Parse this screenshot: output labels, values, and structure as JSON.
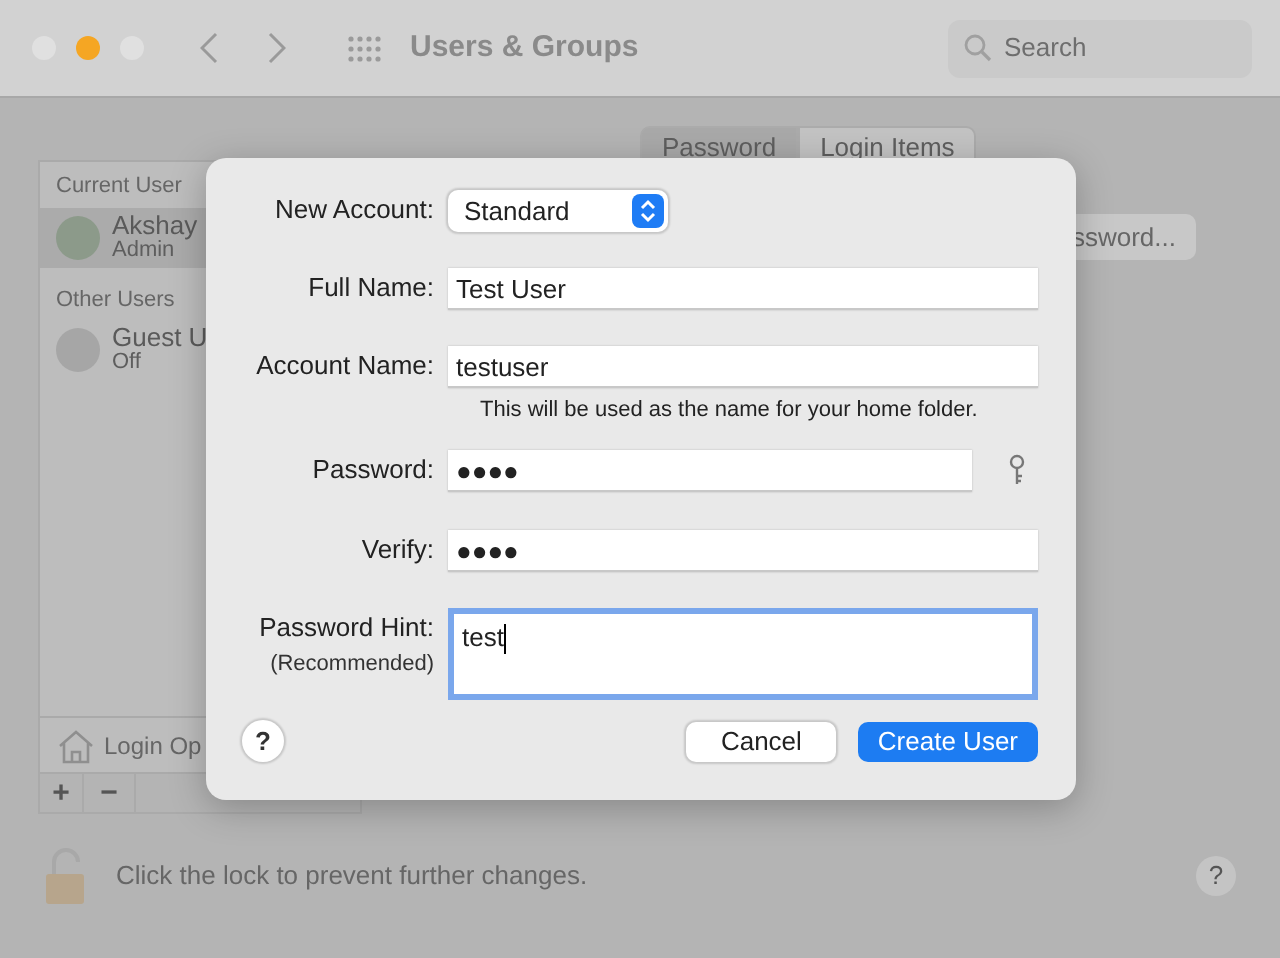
{
  "window": {
    "title": "Users & Groups",
    "search_placeholder": "Search"
  },
  "sidebar": {
    "sections": [
      {
        "header": "Current User",
        "users": [
          {
            "name": "Akshay",
            "role": "Admin",
            "selected": true
          }
        ]
      },
      {
        "header": "Other Users",
        "users": [
          {
            "name": "Guest U",
            "role": "Off",
            "selected": false
          }
        ]
      }
    ],
    "login_options": "Login Op",
    "add": "+",
    "remove": "−"
  },
  "tabs": [
    {
      "label": "Password",
      "selected": true
    },
    {
      "label": "Login Items",
      "selected": false
    }
  ],
  "change_password_button": "ssword...",
  "lock_text": "Click the lock to prevent further changes.",
  "help": "?",
  "dialog": {
    "fields": [
      {
        "kind": "popup",
        "label": "New Account:",
        "value": "Standard"
      },
      {
        "kind": "text",
        "label": "Full Name:",
        "value": "Test User"
      },
      {
        "kind": "text",
        "label": "Account Name:",
        "value": "testuser",
        "note": "This will be used as the name for your home folder."
      },
      {
        "kind": "text",
        "label": "Password:",
        "value": "●●●●",
        "key_button": true
      },
      {
        "kind": "text",
        "label": "Verify:",
        "value": "●●●●"
      },
      {
        "kind": "textarea",
        "label": "Password Hint:",
        "sublabel": "(Recommended)",
        "value": "test",
        "focused": true
      }
    ],
    "help": "?",
    "buttons": [
      {
        "label": "Cancel",
        "default": false
      },
      {
        "label": "Create User",
        "default": true
      }
    ]
  }
}
